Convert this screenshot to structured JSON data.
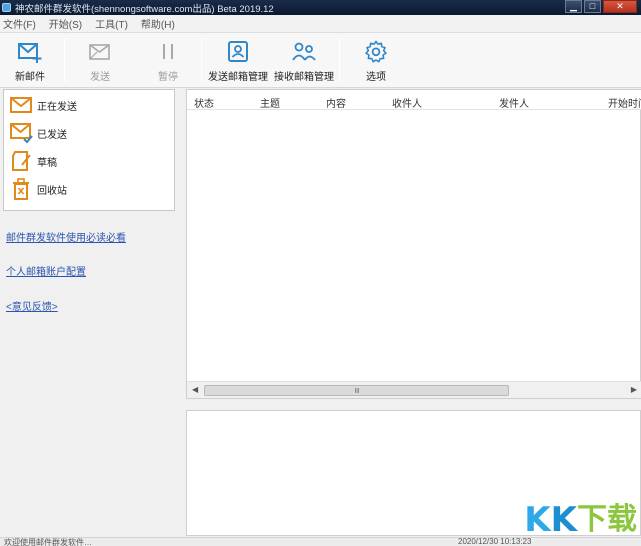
{
  "window": {
    "title": "神农邮件群发软件(shennongsoftware.com出品) Beta 2019.12"
  },
  "menu": [
    "文件(F)",
    "开始(S)",
    "工具(T)",
    "帮助(H)"
  ],
  "toolbar": {
    "new_mail": "新邮件",
    "send": "发送",
    "pause": "暂停",
    "send_mailbox_mgmt": "发送邮箱管理",
    "recv_mailbox_mgmt": "接收邮箱管理",
    "options": "选项"
  },
  "folders": [
    "正在发送",
    "已发送",
    "草稿",
    "回收站"
  ],
  "links": {
    "guide": "邮件群发软件使用必读必看",
    "account_config": "个人邮箱账户配置",
    "feedback": "<意见反馈>"
  },
  "table": {
    "columns": [
      "状态",
      "主题",
      "内容",
      "收件人",
      "发件人",
      "开始时间"
    ],
    "rows": [],
    "scroll_thumb": "Ⅲ"
  },
  "statusbar": {
    "left": "欢迎使用邮件群发软件…",
    "right": "2020/12/30 10:13:23"
  },
  "watermark": {
    "k1": "K",
    "k2": "K",
    "xia": "下",
    "zai": "载"
  },
  "colors": {
    "icon_orange": "#e2891c",
    "icon_blue": "#2f86c8",
    "link_blue": "#2a55b0"
  }
}
